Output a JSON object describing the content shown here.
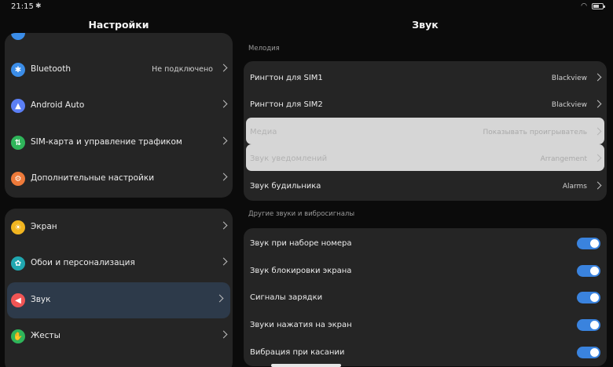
{
  "status_bar": {
    "time": "21:15",
    "bluetooth_icon": "bluetooth-icon",
    "wifi_icon": "wifi-icon",
    "battery_icon": "battery-icon",
    "battery_level": 0.6
  },
  "left_panel": {
    "title": "Настройки",
    "groups": [
      {
        "items": [
          {
            "label": "Bluetooth",
            "value": "Не подключено",
            "icon": "bluetooth-icon",
            "icon_glyph": "✱",
            "color": "#3b8de8"
          },
          {
            "label": "Android Auto",
            "value": "",
            "icon": "android-auto-icon",
            "icon_glyph": "▲",
            "color": "#5b7ff5"
          },
          {
            "label": "SIM-карта и управление трафиком",
            "value": "",
            "icon": "sim-card-icon",
            "icon_glyph": "⇅",
            "color": "#2fb55a"
          },
          {
            "label": "Дополнительные настройки",
            "value": "",
            "icon": "more-settings-icon",
            "icon_glyph": "⚙",
            "color": "#ee7a3a"
          }
        ]
      },
      {
        "items": [
          {
            "label": "Экран",
            "value": "",
            "icon": "display-icon",
            "icon_glyph": "☀",
            "color": "#f1b520"
          },
          {
            "label": "Обои и персонализация",
            "value": "",
            "icon": "wallpaper-icon",
            "icon_glyph": "✿",
            "color": "#20a7b0"
          },
          {
            "label": "Звук",
            "value": "",
            "icon": "sound-icon",
            "icon_glyph": "◀",
            "color": "#f05555",
            "selected": true
          },
          {
            "label": "Жесты",
            "value": "",
            "icon": "gestures-icon",
            "icon_glyph": "✋",
            "color": "#2fb55a"
          }
        ]
      }
    ]
  },
  "right_panel": {
    "title": "Звук",
    "section1": "Мелодия",
    "ringtones": [
      {
        "label": "Рингтон для SIM1",
        "value": "Blackview"
      },
      {
        "label": "Рингтон для SIM2",
        "value": "Blackview"
      },
      {
        "label": "Медиа",
        "value": "Показывать проигрыватель",
        "dim": true
      },
      {
        "label": "Звук уведомлений",
        "value": "Arrangement",
        "dim": true
      },
      {
        "label": "Звук будильника",
        "value": "Alarms"
      }
    ],
    "section2": "Другие звуки и вибросигналы",
    "toggles": [
      {
        "label": "Звук при наборе номера",
        "on": true
      },
      {
        "label": "Звук блокировки экрана",
        "on": true
      },
      {
        "label": "Сигналы зарядки",
        "on": true
      },
      {
        "label": "Звуки нажатия на экран",
        "on": true
      },
      {
        "label": "Вибрация при касании",
        "on": true
      }
    ]
  },
  "colors": {
    "accent": "#3a83de",
    "card": "#252525",
    "background": "#0b0b0b",
    "selected": "#2d3a4a"
  }
}
